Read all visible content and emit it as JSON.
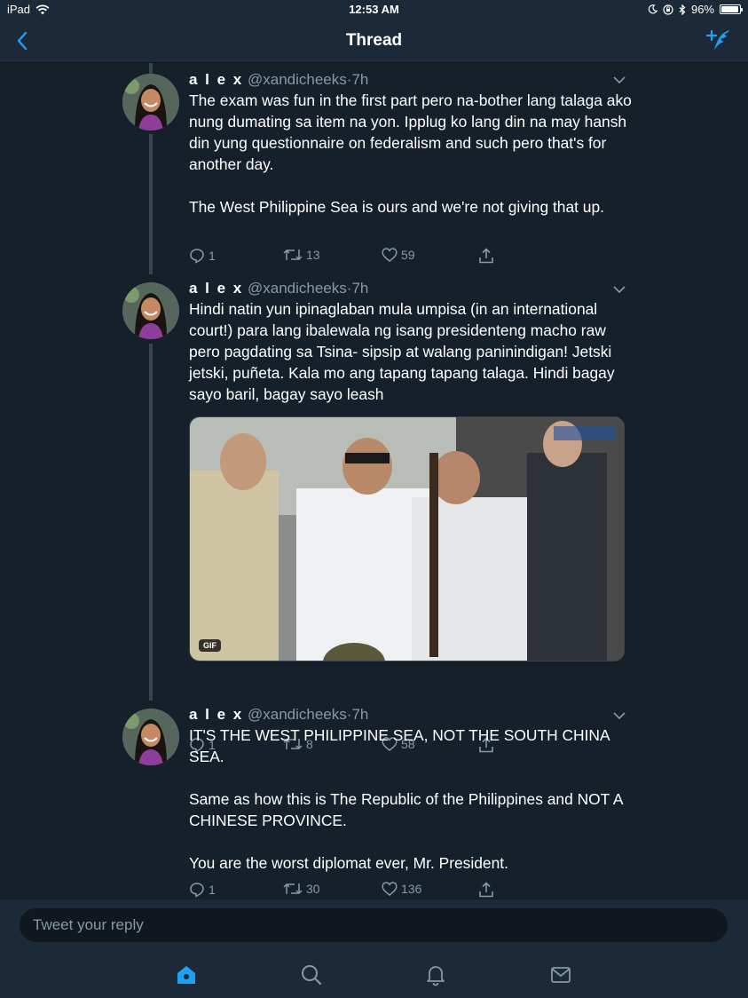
{
  "status_bar": {
    "device": "iPad",
    "time": "12:53 AM",
    "battery": "96%",
    "battery_level": 0.96
  },
  "nav": {
    "title": "Thread",
    "back_icon": "chevron-left-icon",
    "compose_icon": "compose-tweet-icon"
  },
  "tweets": [
    {
      "name": "a l e x",
      "handle": "@xandicheeks",
      "separator": "·",
      "time": "7h",
      "text": "The exam was fun in the first part pero na-bother lang talaga ako nung dumating sa item na yon. Ipplug ko lang din na may hansh din yung questionnaire on federalism and such pero that's for another day.\n\nThe West Philippine Sea is ours and we're not giving that up.",
      "replies": "1",
      "retweets": "13",
      "likes": "59"
    },
    {
      "name": "a l e x",
      "handle": "@xandicheeks",
      "separator": "·",
      "time": "7h",
      "text": "Hindi natin yun ipinaglaban mula umpisa (in an international court!) para lang ibalewala ng isang presidenteng macho raw pero pagdating sa Tsina- sipsip at walang paninindigan! Jetski jetski, puñeta. Kala mo ang tapang tapang talaga. Hindi bagay sayo baril, bagay sayo leash",
      "media_badge": "GIF",
      "replies": "1",
      "retweets": "8",
      "likes": "58"
    },
    {
      "name": "a l e x",
      "handle": "@xandicheeks",
      "separator": "·",
      "time": "7h",
      "text": "IT'S THE WEST PHILIPPINE SEA, NOT THE SOUTH CHINA SEA.\n\nSame as how this is The Republic of the Philippines and NOT A CHINESE PROVINCE.\n\nYou are the worst diplomat ever, Mr. President.",
      "replies": "1",
      "retweets": "30",
      "likes": "136"
    }
  ],
  "reply": {
    "placeholder": "Tweet your reply"
  },
  "tabs": [
    {
      "icon": "home-icon",
      "active": true
    },
    {
      "icon": "search-icon",
      "active": false
    },
    {
      "icon": "notifications-bell-icon",
      "active": false
    },
    {
      "icon": "messages-envelope-icon",
      "active": false
    }
  ],
  "colors": {
    "background": "#15202b",
    "bar": "#1c2938",
    "accent": "#1da1f2",
    "secondary_text": "#8899a6"
  }
}
